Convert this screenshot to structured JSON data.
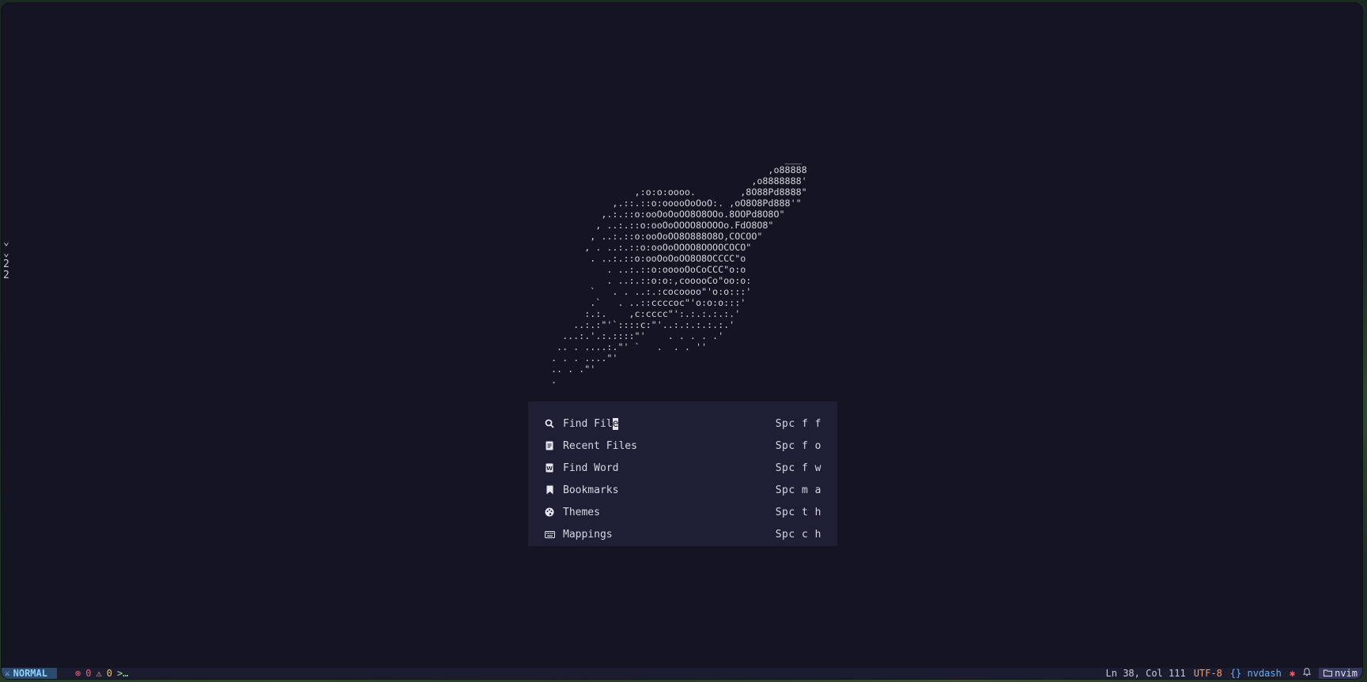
{
  "gutter": {
    "lines": [
      "⌄",
      "⌄",
      "2",
      "2"
    ]
  },
  "ascii_art": "                                          ___\n                                       ,o88888\n                                    ,o8888888'\n               ,:o:o:oooo.        ,8O88Pd8888\"\n           ,.::.::o:ooooOoOoO:. ,oO8O8Pd888'\"\n         ,.:.::o:ooOoOoOO8O8OOo.8OOPd8O8O\"\n        , ..:.::o:ooOoOOOO8OOOOo.FdO8O8\"\n       , ..:.::o:ooOoOO8O888O8O,COCOO\"\n      , . ..:.::o:ooOoOOOO8OOOOCOCO\"\n       . ..:.::o:ooOoOoOO8O8OCCCC\"o\n          . ..:.::o:ooooOoCoCCC\"o:o\n          . ..:.::o:o:,cooooCo\"oo:o:\n       `   . . ..:.:cocoooo\"'o:o:::'\n       .`   . ..::ccccoc\"'o:o:o:::'\n      :.:.    ,c:cccc\"':.:.:.:.:.'\n    ..:.:\"'`::::c:\"'..:.:.:.:.:.'\n  ...:.'.:.::::\"'    . . . . .'\n .. . ....:.\"' `   .  . . ''\n. . . ....\"'\n.. . .\"'\n.",
  "menu": {
    "items": [
      {
        "icon": "search-icon",
        "label": "Find File",
        "keys": "Spc f f"
      },
      {
        "icon": "file-icon",
        "label": "Recent Files",
        "keys": "Spc f o"
      },
      {
        "icon": "word-icon",
        "label": "Find Word",
        "keys": "Spc f w"
      },
      {
        "icon": "bookmark-icon",
        "label": "Bookmarks",
        "keys": "Spc m a"
      },
      {
        "icon": "palette-icon",
        "label": "Themes",
        "keys": "Spc t h"
      },
      {
        "icon": "keyboard-icon",
        "label": "Mappings",
        "keys": "Spc c h"
      }
    ]
  },
  "status": {
    "mode": "NORMAL",
    "errors": "0",
    "warnings": "0",
    "lsp": ">…",
    "position": "Ln 38, Col 111",
    "encoding": "UTF-8",
    "filetype_icon": "{}",
    "filetype": "nvdash",
    "cwd": "nvim"
  },
  "colors": {
    "background": "#141423",
    "menu_background": "#1e1f35",
    "statusbar": "#1b1c2f",
    "mode_accent": "#8fd0ff",
    "error": "#f0596e",
    "warning": "#e5c07b",
    "encoding": "#f0a06a",
    "filetype": "#5fb3ff"
  }
}
